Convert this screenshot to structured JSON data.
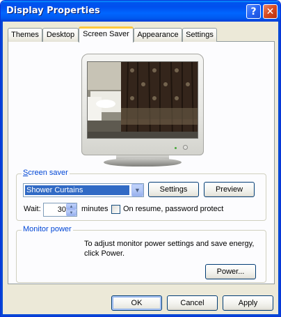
{
  "window": {
    "title": "Display Properties",
    "help_glyph": "?",
    "close_glyph": "✕"
  },
  "tabs": [
    {
      "label": "Themes",
      "active": false
    },
    {
      "label": "Desktop",
      "active": false
    },
    {
      "label": "Screen Saver",
      "active": true
    },
    {
      "label": "Appearance",
      "active": false
    },
    {
      "label": "Settings",
      "active": false
    }
  ],
  "screen_saver": {
    "group_label": "Screen saver",
    "selected": "Shower Curtains",
    "settings_label": "Settings",
    "preview_label": "Preview",
    "wait_label": "Wait:",
    "wait_value": "30",
    "minutes_label": "minutes",
    "resume_label": "On resume, password protect",
    "resume_checked": false
  },
  "monitor_power": {
    "group_label": "Monitor power",
    "description": "To adjust monitor power settings and save energy, click Power.",
    "power_label": "Power..."
  },
  "footer": {
    "ok_label": "OK",
    "cancel_label": "Cancel",
    "apply_label": "Apply"
  },
  "colors": {
    "titlebar": "#0054e3",
    "face": "#ece9d8",
    "group_label": "#0046d5",
    "selection": "#316ac5",
    "active_tab_accent": "#ffc83c"
  },
  "icons": {
    "help": "help-icon",
    "close": "close-icon",
    "dropdown": "chevron-down-icon",
    "spin_up": "spin-up-icon",
    "spin_down": "spin-down-icon"
  }
}
